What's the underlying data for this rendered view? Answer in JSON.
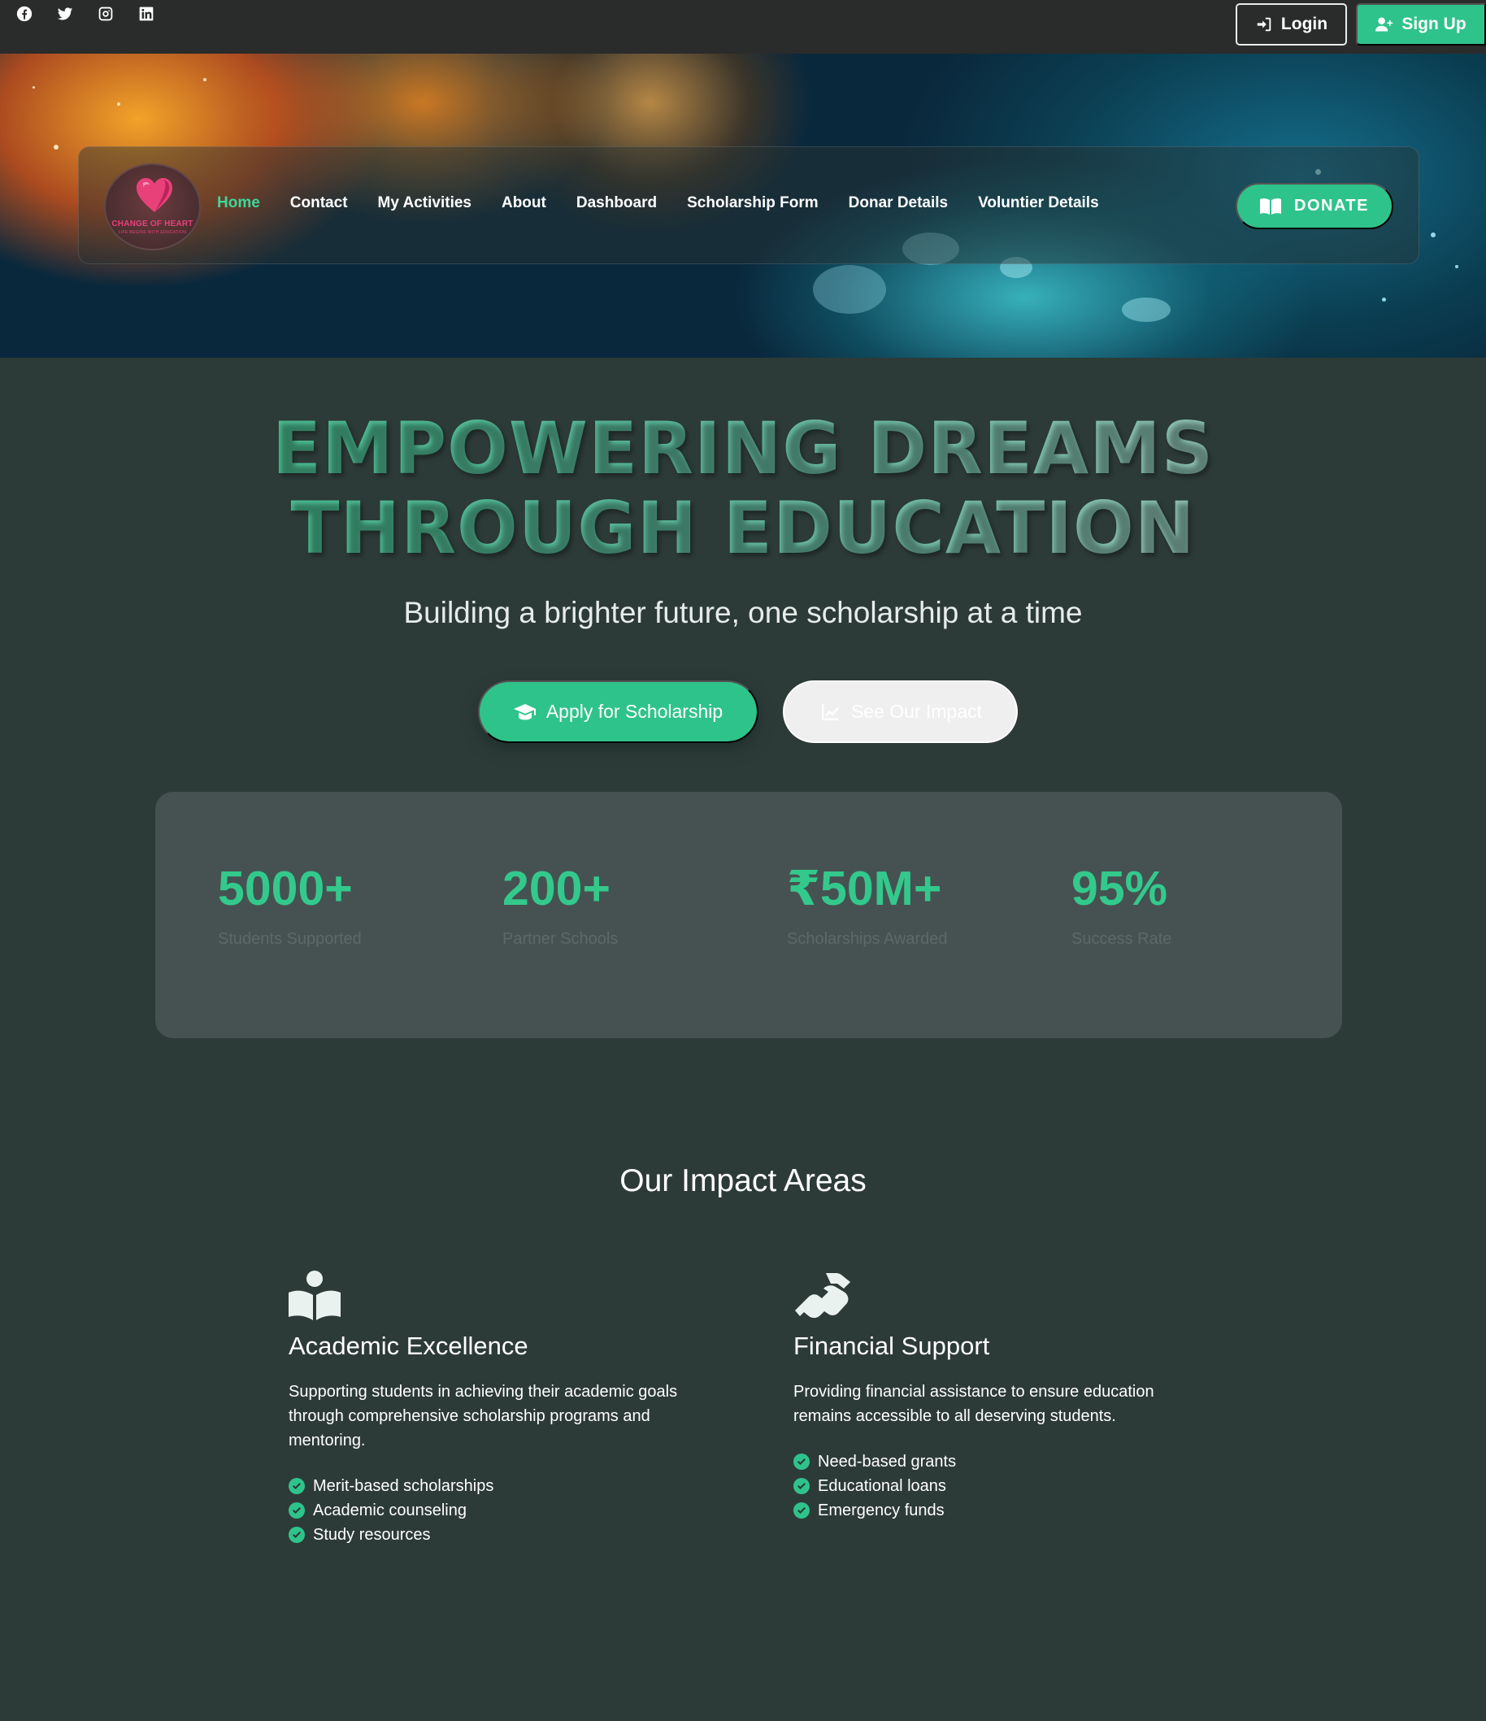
{
  "social": {
    "icons": [
      "facebook-icon",
      "twitter-icon",
      "instagram-icon",
      "linkedin-icon"
    ]
  },
  "auth": {
    "login_label": "Login",
    "signup_label": "Sign Up"
  },
  "logo": {
    "text": "CHANGE OF HEART",
    "subtext": "LIFE BEGINS WITH EDUCATION"
  },
  "nav": {
    "items": [
      {
        "label": "Home",
        "active": true
      },
      {
        "label": "Contact",
        "active": false
      },
      {
        "label": "My Activities",
        "active": false
      },
      {
        "label": "About",
        "active": false
      },
      {
        "label": "Dashboard",
        "active": false
      },
      {
        "label": "Scholarship Form",
        "active": false
      },
      {
        "label": "Donar Details",
        "active": false
      },
      {
        "label": "Voluntier Details",
        "active": false
      }
    ],
    "donate_label": "DONATE"
  },
  "hero": {
    "title_line1": "EMPOWERING DREAMS",
    "title_line2": "THROUGH EDUCATION",
    "subtitle": "Building a brighter future, one scholarship at a time",
    "apply_label": "Apply for Scholarship",
    "impact_label": "See Our Impact"
  },
  "stats": [
    {
      "value": "5000+",
      "label": "Students Supported"
    },
    {
      "value": "200+",
      "label": "Partner Schools"
    },
    {
      "value": "₹50M+",
      "label": "Scholarships Awarded"
    },
    {
      "value": "95%",
      "label": "Success Rate"
    }
  ],
  "impact": {
    "title": "Our Impact Areas",
    "areas": [
      {
        "icon": "book-reader-icon",
        "title": "Academic Excellence",
        "description": "Supporting students in achieving their academic goals through comprehensive scholarship programs and mentoring.",
        "points": [
          "Merit-based scholarships",
          "Academic counseling",
          "Study resources"
        ]
      },
      {
        "icon": "hands-helping-icon",
        "title": "Financial Support",
        "description": "Providing financial assistance to ensure education remains accessible to all deserving students.",
        "points": [
          "Need-based grants",
          "Educational loans",
          "Emergency funds"
        ]
      }
    ]
  },
  "colors": {
    "accent": "#2fc38c",
    "active_nav": "#3fd69a",
    "page_bg": "#2d3b38",
    "stats_bg": "#465251",
    "topbar_bg": "#2a2b2b"
  }
}
